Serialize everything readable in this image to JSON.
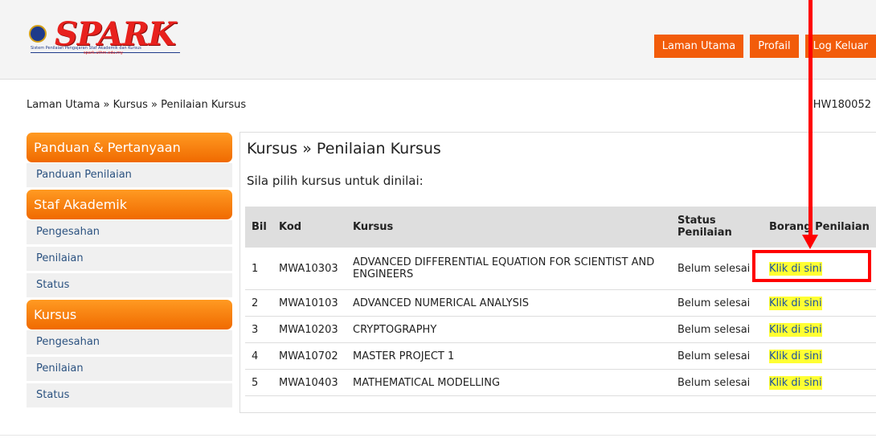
{
  "logo": {
    "word": "SPARK",
    "subtitle": "Sistem Penilaian Pengajaran Staf Akademik dan Kursus",
    "url": "spark.uthm.edu.my"
  },
  "topnav": [
    "Laman Utama",
    "Profail",
    "Log Keluar"
  ],
  "breadcrumb": "Laman Utama » Kursus » Penilaian Kursus",
  "user_id": "HW180052",
  "sidebar": {
    "sections": [
      {
        "title": "Panduan & Pertanyaan",
        "items": [
          "Panduan Penilaian"
        ]
      },
      {
        "title": "Staf Akademik",
        "items": [
          "Pengesahan",
          "Penilaian",
          "Status"
        ]
      },
      {
        "title": "Kursus",
        "items": [
          "Pengesahan",
          "Penilaian",
          "Status"
        ]
      }
    ]
  },
  "main": {
    "title": "Kursus » Penilaian Kursus",
    "instruction": "Sila pilih kursus untuk dinilai:",
    "table": {
      "headers": [
        "Bil",
        "Kod",
        "Kursus",
        "Status Penilaian",
        "Borang Penilaian"
      ],
      "rows": [
        {
          "bil": "1",
          "kod": "MWA10303",
          "kursus": "ADVANCED DIFFERENTIAL EQUATION FOR SCIENTIST AND ENGINEERS",
          "status": "Belum selesai",
          "link": "Klik di sini"
        },
        {
          "bil": "2",
          "kod": "MWA10103",
          "kursus": "ADVANCED NUMERICAL ANALYSIS",
          "status": "Belum selesai",
          "link": "Klik di sini"
        },
        {
          "bil": "3",
          "kod": "MWA10203",
          "kursus": "CRYPTOGRAPHY",
          "status": "Belum selesai",
          "link": "Klik di sini"
        },
        {
          "bil": "4",
          "kod": "MWA10702",
          "kursus": "MASTER PROJECT 1",
          "status": "Belum selesai",
          "link": "Klik di sini"
        },
        {
          "bil": "5",
          "kod": "MWA10403",
          "kursus": "MATHEMATICAL MODELLING",
          "status": "Belum selesai",
          "link": "Klik di sini"
        }
      ]
    }
  },
  "colors": {
    "accent": "#f25c0a",
    "status_text": "#d0021b",
    "link_highlight": "#ffff33",
    "annotation": "#ff0000"
  }
}
